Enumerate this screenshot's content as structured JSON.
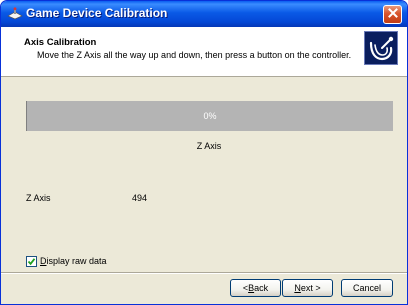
{
  "window": {
    "title": "Game Device Calibration",
    "title_icon": "joystick-icon",
    "close_icon": "close-icon"
  },
  "header": {
    "title": "Axis Calibration",
    "subtitle": "Move the Z Axis all the way up and down, then press a button on the controller.",
    "icon": "joystick-icon"
  },
  "progress": {
    "value_fraction": 0,
    "label": "0%",
    "caption": "Z Axis"
  },
  "raw_data": {
    "label": "Z Axis",
    "value": "494"
  },
  "options": {
    "display_raw_label_prefix": "",
    "display_raw_label_mnemonic": "D",
    "display_raw_label_rest": "isplay raw data",
    "display_raw_checked": true
  },
  "buttons": {
    "back_prefix": "< ",
    "back_mnemonic": "B",
    "back_rest": "ack",
    "next_mnemonic": "N",
    "next_rest": "ext >",
    "cancel": "Cancel"
  },
  "colors": {
    "titlebar": "#0a5ae6",
    "progress_bg": "#b4b4b4",
    "progress_fill": "#3169c6",
    "close_button": "#d8542c"
  }
}
